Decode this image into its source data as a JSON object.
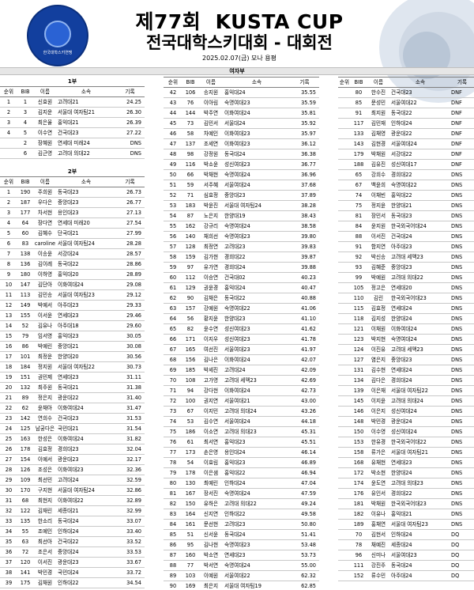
{
  "header": {
    "edition": "제77회",
    "cup": "KUSTA CUP",
    "subtitle": "전국대학스키대회 - 대회전",
    "date": "2025.02.07(금) 모나 용평",
    "logo_ring": "Korea University Ski Team Association",
    "logo_korean": "한국대학스키연맹",
    "side_text": "Korea University Ski"
  },
  "gender": "여자부",
  "columns": [
    "순위",
    "BIB",
    "이름",
    "소속",
    "기록"
  ],
  "div1": {
    "title": "1부",
    "rows": [
      [
        "1",
        "1",
        "신효원",
        "고려대21",
        "24.25"
      ],
      [
        "2",
        "3",
        "김지운",
        "서울대 여자팀21",
        "26.30"
      ],
      [
        "3",
        "4",
        "최은율",
        "홍익대21",
        "26.39"
      ],
      [
        "4",
        "5",
        "이수연",
        "건국대23",
        "27.22"
      ],
      [
        "",
        "2",
        "장혜원",
        "연세대 미래24",
        "DNS"
      ],
      [
        "",
        "6",
        "김근영",
        "고려대 의대22",
        "DNS"
      ]
    ]
  },
  "div2": {
    "title": "2부",
    "rows": [
      [
        "1",
        "190",
        "주희원",
        "동국대23",
        "26.73"
      ],
      [
        "2",
        "187",
        "우다은",
        "중앙대23",
        "26.77"
      ],
      [
        "3",
        "177",
        "차서현",
        "용인대23",
        "27.13"
      ],
      [
        "4",
        "64",
        "장다연",
        "연세대 미래20",
        "27.54"
      ],
      [
        "5",
        "60",
        "김혜수",
        "단국대21",
        "27.99"
      ],
      [
        "6",
        "83",
        "caroline",
        "서울대 여자팀24",
        "28.28"
      ],
      [
        "7",
        "138",
        "이송윤",
        "서강대24",
        "28.57"
      ],
      [
        "8",
        "136",
        "김이레",
        "동국대22",
        "28.86"
      ],
      [
        "9",
        "180",
        "이하영",
        "홍익대20",
        "28.89"
      ],
      [
        "10",
        "147",
        "김단아",
        "이화여대24",
        "29.08"
      ],
      [
        "11",
        "113",
        "김민송",
        "서울대 여자팀23",
        "29.12"
      ],
      [
        "12",
        "149",
        "박예서",
        "아주대23",
        "29.33"
      ],
      [
        "13",
        "155",
        "이서윤",
        "연세대23",
        "29.46"
      ],
      [
        "14",
        "52",
        "김유나",
        "아주대18",
        "29.60"
      ],
      [
        "15",
        "79",
        "임서영",
        "홍익대23",
        "30.05"
      ],
      [
        "16",
        "86",
        "박예린",
        "중앙대21",
        "30.08"
      ],
      [
        "17",
        "101",
        "최정운",
        "한양대20",
        "30.56"
      ],
      [
        "18",
        "184",
        "정지원",
        "서울대 여자팀22",
        "30.73"
      ],
      [
        "19",
        "151",
        "권민제",
        "연세대23",
        "31.11"
      ],
      [
        "20",
        "132",
        "최주원",
        "동국대21",
        "31.38"
      ],
      [
        "21",
        "89",
        "정은지",
        "광운대22",
        "31.40"
      ],
      [
        "22",
        "62",
        "윤채아",
        "이화여대24",
        "31.47"
      ],
      [
        "23",
        "142",
        "연희수",
        "건국대23",
        "31.53"
      ],
      [
        "24",
        "125",
        "남궁다은",
        "국민대21",
        "31.54"
      ],
      [
        "25",
        "163",
        "한성은",
        "이화여대24",
        "31.82"
      ],
      [
        "26",
        "178",
        "김효정",
        "경희대23",
        "32.04"
      ],
      [
        "27",
        "154",
        "이예서",
        "광운대23",
        "32.17"
      ],
      [
        "28",
        "126",
        "조성은",
        "이화여대23",
        "32.36"
      ],
      [
        "29",
        "109",
        "최선민",
        "고려대24",
        "32.59"
      ],
      [
        "30",
        "170",
        "구지현",
        "서울대 여자팀24",
        "32.86"
      ],
      [
        "31",
        "68",
        "최현지",
        "이화여대22",
        "32.89"
      ],
      [
        "32",
        "122",
        "김재린",
        "세종대21",
        "32.99"
      ],
      [
        "33",
        "135",
        "한소리",
        "동국대24",
        "33.07"
      ],
      [
        "34",
        "55",
        "조예인",
        "인하대24",
        "33.40"
      ],
      [
        "35",
        "63",
        "최선아",
        "건국대22",
        "33.52"
      ],
      [
        "36",
        "72",
        "조은서",
        "중앙대24",
        "33.53"
      ],
      [
        "37",
        "120",
        "이서진",
        "광운대23",
        "33.67"
      ],
      [
        "38",
        "141",
        "박민경",
        "국민대24",
        "33.72"
      ],
      [
        "39",
        "175",
        "김채원",
        "인하대22",
        "34.54"
      ],
      [
        "40",
        "69",
        "박신형",
        "서울대 여자팀23",
        "34.80"
      ],
      [
        "41",
        "114",
        "김채은",
        "숙명여대24",
        "35.28"
      ]
    ]
  },
  "mid": {
    "rows": [
      [
        "42",
        "106",
        "송지원",
        "홍익대24",
        "35.55"
      ],
      [
        "43",
        "76",
        "이아림",
        "숙명여대23",
        "35.59"
      ],
      [
        "44",
        "144",
        "박주연",
        "이화여대24",
        "35.81"
      ],
      [
        "45",
        "73",
        "김민서",
        "서울대24",
        "35.92"
      ],
      [
        "46",
        "58",
        "차예인",
        "이화여대23",
        "35.97"
      ],
      [
        "47",
        "137",
        "조세연",
        "이화여대23",
        "36.12"
      ],
      [
        "48",
        "98",
        "강정원",
        "동국대24",
        "36.38"
      ],
      [
        "49",
        "116",
        "박소윤",
        "성신여대23",
        "36.77"
      ],
      [
        "50",
        "66",
        "박채현",
        "숙명여대24",
        "36.96"
      ],
      [
        "51",
        "59",
        "서주혜",
        "서울여대24",
        "37.68"
      ],
      [
        "52",
        "71",
        "심효정",
        "중앙대23",
        "37.89"
      ],
      [
        "53",
        "183",
        "박윤진",
        "서울대 여자팀24",
        "38.28"
      ],
      [
        "54",
        "87",
        "노은지",
        "한양대19",
        "38.43"
      ],
      [
        "55",
        "162",
        "강규리",
        "숙명여대24",
        "38.58"
      ],
      [
        "56",
        "140",
        "채희선",
        "숙명여대23",
        "39.80"
      ],
      [
        "57",
        "128",
        "최정연",
        "고려대23",
        "39.83"
      ],
      [
        "58",
        "159",
        "김가현",
        "경희대22",
        "39.87"
      ],
      [
        "59",
        "97",
        "유가연",
        "경희대24",
        "39.88"
      ],
      [
        "60",
        "112",
        "이승연",
        "건국대02",
        "40.23"
      ],
      [
        "61",
        "129",
        "권윤경",
        "홍익대24",
        "40.47"
      ],
      [
        "62",
        "90",
        "김채은",
        "동국대22",
        "40.88"
      ],
      [
        "63",
        "157",
        "강예원",
        "숙명여대22",
        "41.06"
      ],
      [
        "64",
        "56",
        "황지윤",
        "한양대23",
        "41.10"
      ],
      [
        "65",
        "82",
        "윤수연",
        "성신여대23",
        "41.62"
      ],
      [
        "66",
        "171",
        "이지우",
        "성신여대23",
        "41.78"
      ],
      [
        "67",
        "165",
        "여선진",
        "서울여대23",
        "41.97"
      ],
      [
        "68",
        "156",
        "김나은",
        "이화여대24",
        "42.07"
      ],
      [
        "69",
        "185",
        "박세진",
        "고려대24",
        "42.09"
      ],
      [
        "70",
        "108",
        "고가영",
        "고려대 세맥23",
        "42.69"
      ],
      [
        "71",
        "94",
        "강다현",
        "이화여대24",
        "42.73"
      ],
      [
        "72",
        "100",
        "권지연",
        "서울여대21",
        "43.00"
      ],
      [
        "73",
        "67",
        "이지민",
        "고려대 의대24",
        "43.26"
      ],
      [
        "74",
        "53",
        "김수연",
        "서울여대24",
        "44.18"
      ],
      [
        "75",
        "186",
        "이소연",
        "고려대 의대23",
        "45.31"
      ],
      [
        "76",
        "61",
        "최서연",
        "홍익대23",
        "45.51"
      ],
      [
        "77",
        "173",
        "손은영",
        "용인대24",
        "46.14"
      ],
      [
        "78",
        "54",
        "이효림",
        "홍익대23",
        "46.89"
      ],
      [
        "79",
        "178",
        "이은샘",
        "홍익대22",
        "46.94"
      ],
      [
        "80",
        "130",
        "최예린",
        "인하대24",
        "47.04"
      ],
      [
        "81",
        "167",
        "장서진",
        "숙명여대24",
        "47.59"
      ],
      [
        "82",
        "150",
        "유하은",
        "고려대 의대22",
        "49.24"
      ],
      [
        "83",
        "164",
        "신지연",
        "인하대22",
        "49.58"
      ],
      [
        "84",
        "161",
        "문선현",
        "고려대23",
        "50.80"
      ],
      [
        "85",
        "51",
        "신서윤",
        "동국대24",
        "51.41"
      ],
      [
        "86",
        "95",
        "김나현",
        "숙명여대23",
        "53.48"
      ],
      [
        "87",
        "160",
        "박소연",
        "연세대23",
        "53.73"
      ],
      [
        "88",
        "77",
        "박서연",
        "숙명여대24",
        "55.00"
      ],
      [
        "89",
        "103",
        "이예원",
        "서울여대22",
        "62.32"
      ],
      [
        "90",
        "169",
        "최은지",
        "서울대 여자팀19",
        "62.85"
      ],
      [
        "91",
        "104",
        "김가예",
        "성신여대24",
        "64.98"
      ],
      [
        "92",
        "166",
        "정혜윤",
        "건국대24",
        "82.60"
      ]
    ]
  },
  "right": {
    "rows": [
      [
        "80",
        "한수진",
        "건국대23",
        "DNF"
      ],
      [
        "85",
        "문성민",
        "서울여대22",
        "DNF"
      ],
      [
        "91",
        "최지원",
        "동국대22",
        "DNF"
      ],
      [
        "117",
        "김민재",
        "인하대24",
        "DNF"
      ],
      [
        "133",
        "김채영",
        "광운대22",
        "DNF"
      ],
      [
        "143",
        "김현경",
        "서울여대24",
        "DNF"
      ],
      [
        "179",
        "박채원",
        "서강대22",
        "DNF"
      ],
      [
        "188",
        "김유진",
        "성신여대17",
        "DNF"
      ],
      [
        "65",
        "강희수",
        "경희대22",
        "DNS"
      ],
      [
        "67",
        "백윤희",
        "숙명여대22",
        "DNS"
      ],
      [
        "74",
        "이채빈",
        "홍익대22",
        "DNS"
      ],
      [
        "75",
        "정지윤",
        "한양대21",
        "DNS"
      ],
      [
        "81",
        "장민서",
        "동국대23",
        "DNS"
      ],
      [
        "84",
        "윤지원",
        "한국외국어대24",
        "DNS"
      ],
      [
        "88",
        "이서진",
        "건국대24",
        "DNS"
      ],
      [
        "91",
        "함지연",
        "아주대23",
        "DNS"
      ],
      [
        "92",
        "박신송",
        "고려대 세맥23",
        "DNS"
      ],
      [
        "93",
        "김혜준",
        "중앙대23",
        "DNS"
      ],
      [
        "99",
        "박예원",
        "고려대 의대22",
        "DNS"
      ],
      [
        "105",
        "정고은",
        "연세대20",
        "DNS"
      ],
      [
        "110",
        "김린",
        "한국외국어대23",
        "DNS"
      ],
      [
        "115",
        "김효정",
        "연세대24",
        "DNS"
      ],
      [
        "118",
        "김지성",
        "한양대24",
        "DNS"
      ],
      [
        "121",
        "이채원",
        "이화여대24",
        "DNS"
      ],
      [
        "123",
        "박지현",
        "숙명여대24",
        "DNS"
      ],
      [
        "124",
        "이진유",
        "고려대 세맥23",
        "DNS"
      ],
      [
        "127",
        "염은지",
        "중앙대23",
        "DNS"
      ],
      [
        "131",
        "김수현",
        "연세대24",
        "DNS"
      ],
      [
        "134",
        "김다은",
        "경희대24",
        "DNS"
      ],
      [
        "139",
        "이은재",
        "서울대 여자팀22",
        "DNS"
      ],
      [
        "145",
        "이지윤",
        "고려대 의대24",
        "DNS"
      ],
      [
        "146",
        "이은지",
        "성신여대24",
        "DNS"
      ],
      [
        "148",
        "박민경",
        "광운대24",
        "DNS"
      ],
      [
        "150",
        "이수영",
        "성신여대24",
        "DNS"
      ],
      [
        "153",
        "한유경",
        "한국외국어대22",
        "DNS"
      ],
      [
        "158",
        "류가은",
        "서울대 여자팀21",
        "DNS"
      ],
      [
        "168",
        "유채현",
        "연세대23",
        "DNS"
      ],
      [
        "172",
        "박소현",
        "한양대24",
        "DNS"
      ],
      [
        "174",
        "윤도연",
        "고려대 의대23",
        "DNS"
      ],
      [
        "176",
        "유인서",
        "경희대22",
        "DNS"
      ],
      [
        "181",
        "박채원",
        "한국외국어대23",
        "DNS"
      ],
      [
        "182",
        "이유나",
        "홍익대21",
        "DNS"
      ],
      [
        "189",
        "홍채연",
        "서울대 여자팀23",
        "DNS"
      ],
      [
        "70",
        "김현서",
        "인하대24",
        "DQ"
      ],
      [
        "78",
        "채예진",
        "세종대24",
        "DQ"
      ],
      [
        "96",
        "신미나",
        "서울여대23",
        "DQ"
      ],
      [
        "111",
        "강진주",
        "동국대24",
        "DQ"
      ],
      [
        "152",
        "류수민",
        "아주대24",
        "DQ"
      ]
    ]
  }
}
